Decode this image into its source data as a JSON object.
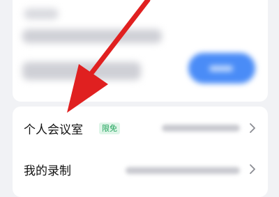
{
  "list": {
    "items": [
      {
        "label": "个人会议室",
        "tag": "限免"
      },
      {
        "label": "我的录制"
      }
    ]
  },
  "colors": {
    "background": "#f1f2f5",
    "card": "#ffffff",
    "accent_blue": "#4a8cf7",
    "tag_text": "#1fa35a",
    "tag_bg": "#dff5e8",
    "arrow": "#e02020"
  },
  "icons": [
    "chevron-right-icon",
    "red-annotation-arrow"
  ]
}
